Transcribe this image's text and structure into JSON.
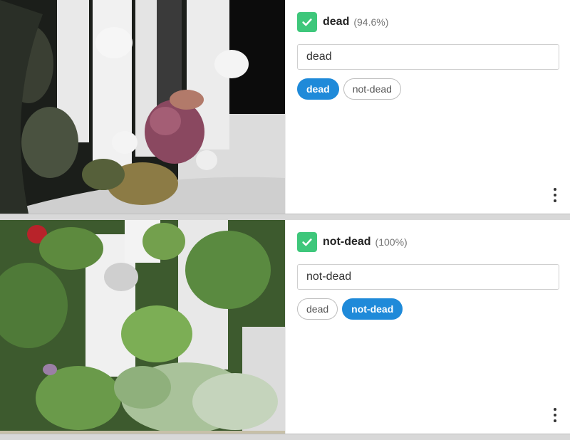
{
  "items": [
    {
      "label": "dead",
      "confidence": "(94.6%)",
      "input_value": "dead",
      "options": [
        "dead",
        "not-dead"
      ],
      "selected": "dead",
      "photo_icon": "plant-tower-photo"
    },
    {
      "label": "not-dead",
      "confidence": "(100%)",
      "input_value": "not-dead",
      "options": [
        "dead",
        "not-dead"
      ],
      "selected": "not-dead",
      "photo_icon": "plant-tower-photo"
    }
  ],
  "colors": {
    "accent_blue": "#1f8ad9",
    "check_green": "#3ec77b"
  }
}
